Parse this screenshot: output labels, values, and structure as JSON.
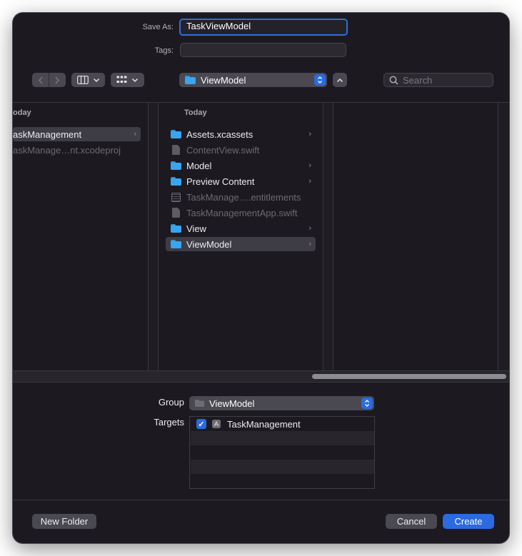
{
  "save_as": {
    "label": "Save As:",
    "value": "TaskViewModel"
  },
  "tags": {
    "label": "Tags:",
    "value": ""
  },
  "toolbar": {
    "location": "ViewModel",
    "search_placeholder": "Search",
    "icons": [
      "chevron-left-icon",
      "chevron-right-icon",
      "columns-view-icon",
      "grid-view-icon",
      "chevron-up-icon",
      "search-icon"
    ]
  },
  "browser": {
    "col1": {
      "header": "oday",
      "items": [
        {
          "label": "askManagement",
          "type": "folder",
          "selected": true,
          "dim": false
        },
        {
          "label": "askManage…nt.xcodeproj",
          "type": "file",
          "selected": false,
          "dim": true
        }
      ]
    },
    "col2": {
      "header": "Today",
      "items": [
        {
          "label": "Assets.xcassets",
          "type": "folder",
          "selected": false,
          "dim": false
        },
        {
          "label": "ContentView.swift",
          "type": "doc",
          "selected": false,
          "dim": true
        },
        {
          "label": "Model",
          "type": "folder",
          "selected": false,
          "dim": false
        },
        {
          "label": "Preview Content",
          "type": "folder",
          "selected": false,
          "dim": false
        },
        {
          "label": "TaskManage….entitlements",
          "type": "entitlements",
          "selected": false,
          "dim": true
        },
        {
          "label": "TaskManagementApp.swift",
          "type": "doc",
          "selected": false,
          "dim": true
        },
        {
          "label": "View",
          "type": "folder",
          "selected": false,
          "dim": false
        },
        {
          "label": "ViewModel",
          "type": "folder",
          "selected": true,
          "dim": false
        }
      ]
    }
  },
  "group": {
    "label": "Group",
    "value": "ViewModel"
  },
  "targets": {
    "label": "Targets",
    "items": [
      {
        "label": "TaskManagement",
        "checked": true
      }
    ]
  },
  "buttons": {
    "new_folder": "New Folder",
    "cancel": "Cancel",
    "create": "Create"
  },
  "colors": {
    "accent": "#2b6ae0",
    "folder": "#37a6f2",
    "background": "#1c1a20"
  }
}
